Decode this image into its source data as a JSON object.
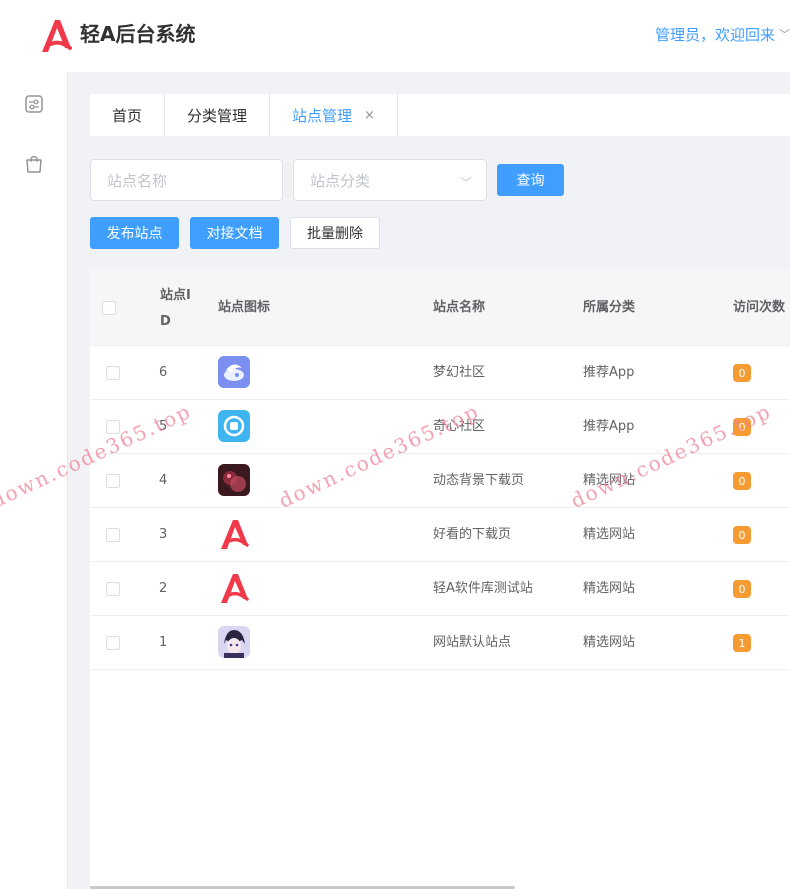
{
  "header": {
    "title": "轻A后台系统",
    "user_greeting": "管理员，欢迎回来",
    "brand_color": "#f0394a"
  },
  "sidebar": {
    "items": [
      {
        "icon": "settings-sliders-icon"
      },
      {
        "icon": "shopping-bag-icon"
      }
    ]
  },
  "tabs": [
    {
      "label": "首页"
    },
    {
      "label": "分类管理"
    },
    {
      "label": "站点管理",
      "active": true
    }
  ],
  "tab_close": "×",
  "filters": {
    "site_name_placeholder": "站点名称",
    "category_placeholder": "站点分类",
    "query_label": "查询"
  },
  "actions": {
    "publish_label": "发布站点",
    "docs_label": "对接文档",
    "batch_delete_label": "批量删除"
  },
  "table": {
    "headers": {
      "id_line1": "站点I",
      "id_line2": "D",
      "icon": "站点图标",
      "name": "站点名称",
      "category": "所属分类",
      "visits": "访问次数"
    },
    "rows": [
      {
        "id": "6",
        "icon": "dream-community-icon",
        "name": "梦幻社区",
        "category": "推荐App",
        "visits": "0"
      },
      {
        "id": "5",
        "icon": "qixin-community-icon",
        "name": "奇心社区",
        "category": "推荐App",
        "visits": "0"
      },
      {
        "id": "4",
        "icon": "dynamic-bg-thumbnail-icon",
        "name": "动态背景下载页",
        "category": "精选网站",
        "visits": "0"
      },
      {
        "id": "3",
        "icon": "light-a-logo-icon",
        "name": "好看的下载页",
        "category": "精选网站",
        "visits": "0"
      },
      {
        "id": "2",
        "icon": "light-a-logo-icon",
        "name": "轻A软件库测试站",
        "category": "精选网站",
        "visits": "0"
      },
      {
        "id": "1",
        "icon": "anime-avatar-icon",
        "name": "网站默认站点",
        "category": "精选网站",
        "visits": "1"
      }
    ]
  },
  "watermarks": [
    "down.code365.top",
    "down.code365.top",
    "down.code365.top"
  ]
}
